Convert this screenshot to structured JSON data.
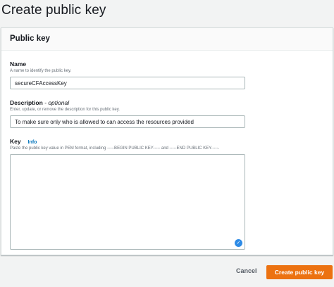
{
  "page": {
    "title": "Create public key"
  },
  "panel": {
    "title": "Public key"
  },
  "name_field": {
    "label": "Name",
    "description": "A name to identify the public key.",
    "value": "secureCFAccessKey"
  },
  "description_field": {
    "label": "Description",
    "optional_label": "- optional",
    "description": "Enter, update, or remove the description for this public key.",
    "value": "To make sure only who is allowed to can access the resources provided"
  },
  "key_field": {
    "label": "Key",
    "info_link": "Info",
    "description": "Paste the public key value in PEM format, including -----BEGIN PUBLIC KEY----- and -----END PUBLIC KEY-----.",
    "value": ""
  },
  "actions": {
    "cancel_label": "Cancel",
    "create_label": "Create public key"
  },
  "icons": {
    "textarea_assist": "grammarly-check-icon"
  },
  "colors": {
    "primary_button": "#ec7211",
    "link": "#0073bb",
    "background": "#f2f3f3"
  }
}
